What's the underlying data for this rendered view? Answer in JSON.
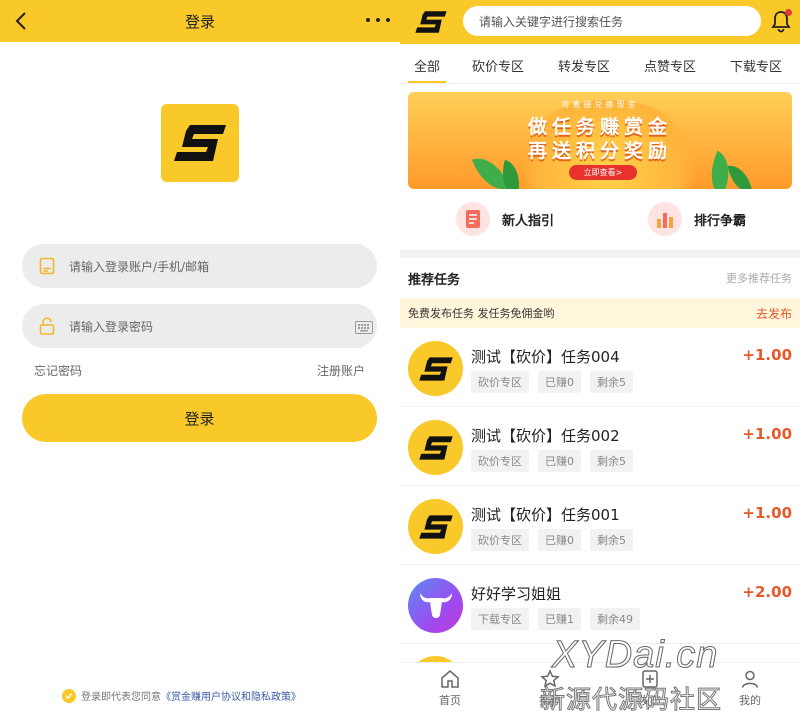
{
  "login_screen": {
    "header": {
      "title": "登录"
    },
    "account_placeholder": "请输入登录账户/手机/邮箱",
    "password_placeholder": "请输入登录密码",
    "forgot_password": "忘记密码",
    "register": "注册账户",
    "login_button": "登录",
    "agreement": {
      "prefix": "登录即代表您同意",
      "link": "《赏金赚用户协议和隐私政策》"
    }
  },
  "task_screen": {
    "search_placeholder": "请输入关键字进行搜索任务",
    "tabs": [
      "全部",
      "砍价专区",
      "转发专区",
      "点赞专区",
      "下载专区"
    ],
    "active_tab": "全部",
    "banner": {
      "subtitle": "可直接兑换现金",
      "line1": "做任务赚赏金",
      "line2": "再送积分奖励",
      "cta": "立即查看>"
    },
    "shortcuts": [
      {
        "label": "新人指引",
        "icon": "guide-icon"
      },
      {
        "label": "排行争霸",
        "icon": "ranking-icon"
      }
    ],
    "recommend": {
      "title": "推荐任务",
      "more": "更多推荐任务"
    },
    "notice": {
      "text": "免费发布任务 发任务免佣金哟",
      "action": "去发布"
    },
    "tasks": [
      {
        "name": "测试【砍价】任务004",
        "zone": "砍价专区",
        "earned": "已赚0",
        "remaining": "剩余5",
        "reward": "+1.00",
        "avatar": "logo-s"
      },
      {
        "name": "测试【砍价】任务002",
        "zone": "砍价专区",
        "earned": "已赚0",
        "remaining": "剩余5",
        "reward": "+1.00",
        "avatar": "logo-s"
      },
      {
        "name": "测试【砍价】任务001",
        "zone": "砍价专区",
        "earned": "已赚0",
        "remaining": "剩余5",
        "reward": "+1.00",
        "avatar": "logo-s"
      },
      {
        "name": "好好学习姐姐",
        "zone": "下载专区",
        "earned": "已赚1",
        "remaining": "剩余49",
        "reward": "+2.00",
        "avatar": "bull"
      }
    ],
    "tabbar": [
      {
        "label": "首页",
        "icon": "home-icon"
      },
      {
        "label": "推荐",
        "icon": "star-icon"
      },
      {
        "label": "发布",
        "icon": "publish-icon"
      },
      {
        "label": "我的",
        "icon": "user-icon"
      }
    ],
    "colors": {
      "brand": "#f9c929",
      "accent": "#e8582a"
    }
  },
  "watermark": {
    "line1": "XYDai.cn",
    "line2": "新源代源码社区"
  }
}
